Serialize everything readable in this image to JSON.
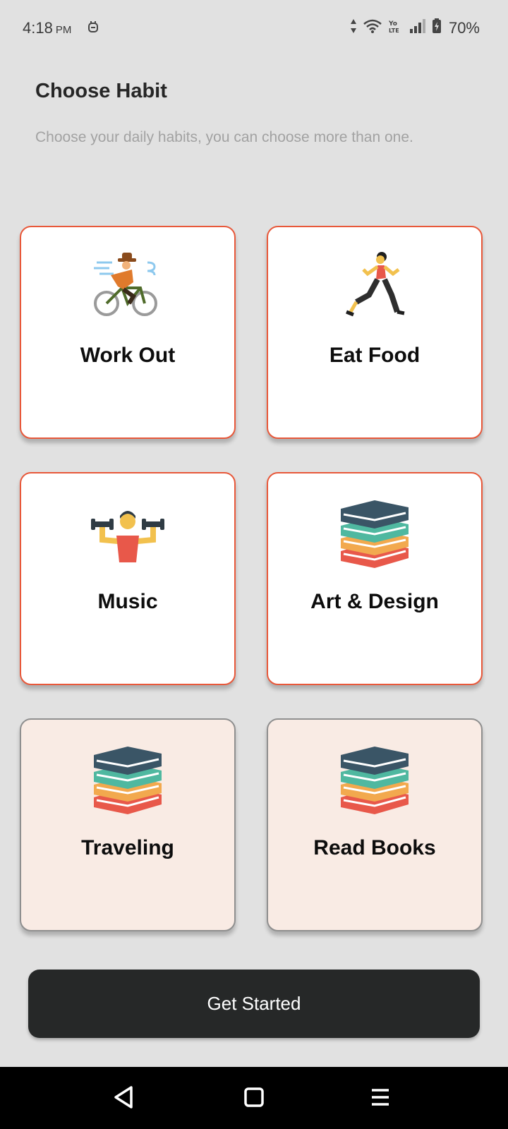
{
  "status_bar": {
    "time": "4:18",
    "ampm": "PM",
    "battery": "70%",
    "icons": [
      "notification-icon",
      "data-arrows-icon",
      "wifi-icon",
      "volte-icon",
      "signal-icon",
      "battery-charging-icon"
    ]
  },
  "header": {
    "title": "Choose Habit",
    "subtitle": "Choose your daily habits, you can choose more than one."
  },
  "habits": [
    {
      "label": "Work Out",
      "icon": "cyclist-icon",
      "selected": true
    },
    {
      "label": "Eat Food",
      "icon": "runner-icon",
      "selected": true
    },
    {
      "label": "Music",
      "icon": "dumbbell-lifter-icon",
      "selected": true
    },
    {
      "label": "Art & Design",
      "icon": "books-stack-icon",
      "selected": true
    },
    {
      "label": "Traveling",
      "icon": "books-stack-icon",
      "selected": false
    },
    {
      "label": "Read Books",
      "icon": "books-stack-icon",
      "selected": false
    }
  ],
  "cta": {
    "label": "Get Started"
  },
  "nav": {
    "icons": [
      "back-icon",
      "home-icon",
      "recents-icon"
    ]
  },
  "colors": {
    "selected_border": "#e8583a",
    "unselected_bg": "#f9ebe4",
    "button_bg": "#262828",
    "page_bg": "#e1e1e1"
  }
}
